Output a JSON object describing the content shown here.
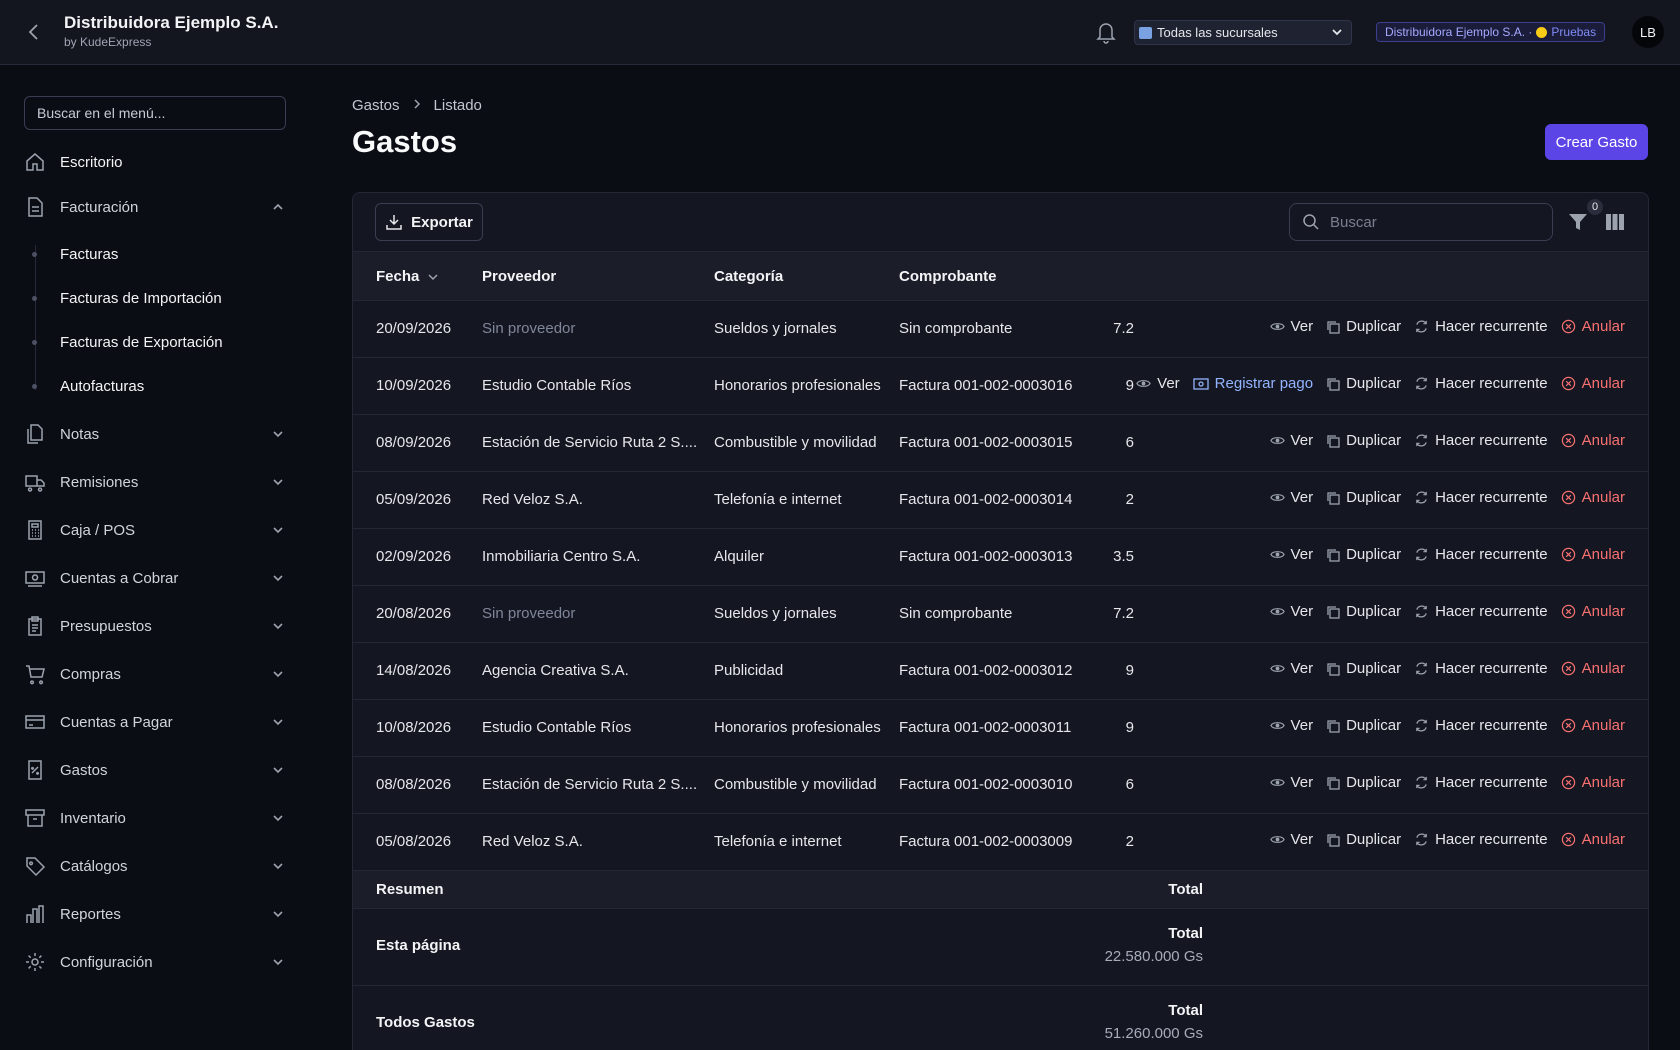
{
  "header": {
    "company": "Distribuidora Ejemplo S.A.",
    "subtitle": "by KudeExpress",
    "branch_selected": "Todas las sucursales",
    "env_company": "Distribuidora Ejemplo S.A. ·",
    "env_label": "Pruebas",
    "avatar": "LB"
  },
  "sidebar": {
    "search_placeholder": "Buscar en el menú...",
    "items": [
      {
        "label": "Escritorio",
        "icon": "home-icon"
      },
      {
        "label": "Facturación",
        "icon": "document-icon"
      },
      {
        "label": "Notas",
        "icon": "documents-icon"
      },
      {
        "label": "Remisiones",
        "icon": "truck-icon"
      },
      {
        "label": "Caja / POS",
        "icon": "calculator-icon"
      },
      {
        "label": "Cuentas a Cobrar",
        "icon": "cash-icon"
      },
      {
        "label": "Presupuestos",
        "icon": "clipboard-icon"
      },
      {
        "label": "Compras",
        "icon": "cart-icon"
      },
      {
        "label": "Cuentas a Pagar",
        "icon": "card-icon"
      },
      {
        "label": "Gastos",
        "icon": "receipt-icon"
      },
      {
        "label": "Inventario",
        "icon": "archive-icon"
      },
      {
        "label": "Catálogos",
        "icon": "tag-icon"
      },
      {
        "label": "Reportes",
        "icon": "chart-icon"
      },
      {
        "label": "Configuración",
        "icon": "gear-icon"
      }
    ],
    "subitems": [
      {
        "label": "Facturas"
      },
      {
        "label": "Facturas de Importación"
      },
      {
        "label": "Facturas de Exportación"
      },
      {
        "label": "Autofacturas"
      }
    ]
  },
  "breadcrumb": {
    "root": "Gastos",
    "current": "Listado"
  },
  "page": {
    "title": "Gastos",
    "create_button": "Crear Gasto"
  },
  "toolbar": {
    "export_label": "Exportar",
    "search_placeholder": "Buscar",
    "filter_count": "0"
  },
  "table": {
    "headers": {
      "fecha": "Fecha",
      "proveedor": "Proveedor",
      "categoria": "Categoría",
      "comprobante": "Comprobante"
    },
    "actions": {
      "ver": "Ver",
      "registrar": "Registrar pago",
      "duplicar": "Duplicar",
      "recurrente": "Hacer recurrente",
      "anular": "Anular"
    },
    "rows": [
      {
        "fecha": "20/09/2026",
        "proveedor": "Sin proveedor",
        "categoria": "Sueldos y jornales",
        "comprobante": "Sin comprobante",
        "monto": "7.2",
        "registrar": false
      },
      {
        "fecha": "10/09/2026",
        "proveedor": "Estudio Contable Ríos",
        "categoria": "Honorarios profesionales",
        "comprobante": "Factura 001-002-0003016",
        "monto": "9",
        "registrar": true
      },
      {
        "fecha": "08/09/2026",
        "proveedor": "Estación de Servicio Ruta 2 S....",
        "categoria": "Combustible y movilidad",
        "comprobante": "Factura 001-002-0003015",
        "monto": "6",
        "registrar": false
      },
      {
        "fecha": "05/09/2026",
        "proveedor": "Red Veloz S.A.",
        "categoria": "Telefonía e internet",
        "comprobante": "Factura 001-002-0003014",
        "monto": "2",
        "registrar": false
      },
      {
        "fecha": "02/09/2026",
        "proveedor": "Inmobiliaria Centro S.A.",
        "categoria": "Alquiler",
        "comprobante": "Factura 001-002-0003013",
        "monto": "3.5",
        "registrar": false
      },
      {
        "fecha": "20/08/2026",
        "proveedor": "Sin proveedor",
        "categoria": "Sueldos y jornales",
        "comprobante": "Sin comprobante",
        "monto": "7.2",
        "registrar": false
      },
      {
        "fecha": "14/08/2026",
        "proveedor": "Agencia Creativa S.A.",
        "categoria": "Publicidad",
        "comprobante": "Factura 001-002-0003012",
        "monto": "9",
        "registrar": false
      },
      {
        "fecha": "10/08/2026",
        "proveedor": "Estudio Contable Ríos",
        "categoria": "Honorarios profesionales",
        "comprobante": "Factura 001-002-0003011",
        "monto": "9",
        "registrar": false
      },
      {
        "fecha": "08/08/2026",
        "proveedor": "Estación de Servicio Ruta 2 S....",
        "categoria": "Combustible y movilidad",
        "comprobante": "Factura 001-002-0003010",
        "monto": "6",
        "registrar": false
      },
      {
        "fecha": "05/08/2026",
        "proveedor": "Red Veloz S.A.",
        "categoria": "Telefonía e internet",
        "comprobante": "Factura 001-002-0003009",
        "monto": "2",
        "registrar": false
      }
    ]
  },
  "summary": {
    "head_label": "Resumen",
    "head_total": "Total",
    "page_label": "Esta página",
    "page_total_label": "Total",
    "page_total": "22.580.000 Gs",
    "all_label": "Todos Gastos",
    "all_total_label": "Total",
    "all_total": "51.260.000 Gs"
  },
  "colors": {
    "accent": "#5b45e6",
    "danger": "#f87171",
    "link": "#93b4ff"
  }
}
